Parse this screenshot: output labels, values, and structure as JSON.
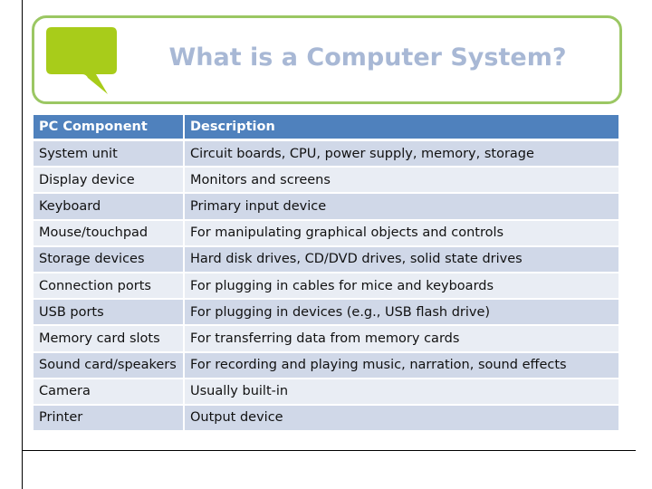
{
  "slide": {
    "title": "What is a Computer System?",
    "icon": "speech-bubble-icon",
    "colors": {
      "title_text": "#a8b8d5",
      "box_border": "#9bc763",
      "bubble": "#a8cc1a",
      "header_bg": "#4f81bd",
      "row_odd": "#d0d8e8",
      "row_even": "#e9edf4"
    }
  },
  "table": {
    "headers": [
      "PC Component",
      "Description"
    ],
    "rows": [
      [
        "System unit",
        "Circuit boards, CPU, power supply, memory, storage"
      ],
      [
        "Display device",
        "Monitors and screens"
      ],
      [
        "Keyboard",
        "Primary input device"
      ],
      [
        "Mouse/touchpad",
        "For manipulating graphical objects and controls"
      ],
      [
        "Storage devices",
        "Hard disk drives, CD/DVD drives, solid state drives"
      ],
      [
        "Connection ports",
        "For plugging in cables for mice and keyboards"
      ],
      [
        "USB ports",
        "For plugging in devices (e.g., USB flash drive)"
      ],
      [
        "Memory card slots",
        "For transferring data from memory cards"
      ],
      [
        "Sound card/speakers",
        "For recording and playing music, narration, sound effects"
      ],
      [
        "Camera",
        "Usually built-in"
      ],
      [
        "Printer",
        "Output device"
      ]
    ]
  }
}
